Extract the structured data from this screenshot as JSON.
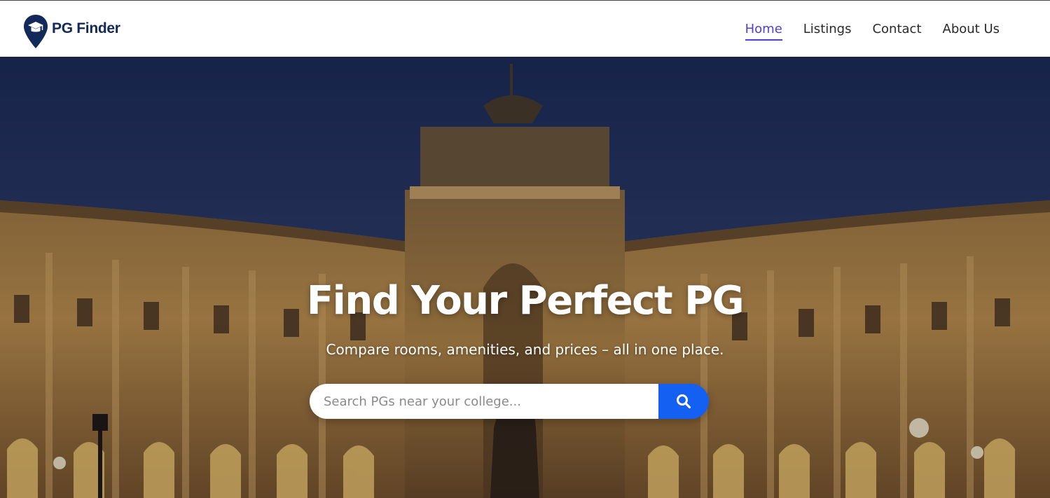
{
  "brand": {
    "name": "PG Finder",
    "logo_icon": "map-pin-graduation-cap-icon",
    "color": "#13295a"
  },
  "nav": {
    "active_color": "#4f3fd9",
    "items": [
      {
        "label": "Home",
        "active": true
      },
      {
        "label": "Listings",
        "active": false
      },
      {
        "label": "Contact",
        "active": false
      },
      {
        "label": "About Us",
        "active": false
      }
    ]
  },
  "hero": {
    "title": "Find Your Perfect PG",
    "subtitle": "Compare rooms, amenities, and prices – all in one place.",
    "background": "illuminated-palace-at-dusk"
  },
  "search": {
    "placeholder": "Search PGs near your college...",
    "value": "",
    "button_icon": "search-icon",
    "button_color": "#1460f2"
  }
}
